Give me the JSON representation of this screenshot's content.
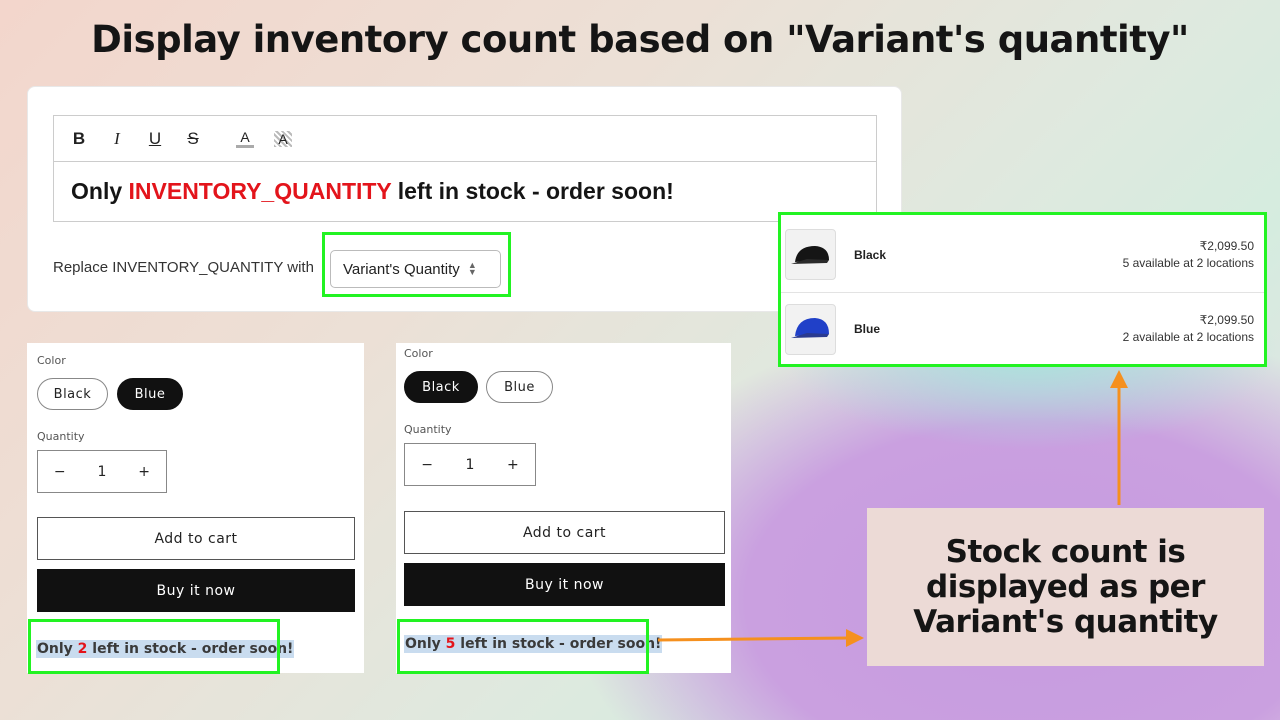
{
  "title": "Display inventory count based on \"Variant's quantity\"",
  "editor": {
    "toolbar": [
      {
        "icon": "bold-icon",
        "glyph": "B"
      },
      {
        "icon": "italic-icon",
        "glyph": "I"
      },
      {
        "icon": "underline-icon",
        "glyph": "U"
      },
      {
        "icon": "strikethrough-icon",
        "glyph": "S"
      },
      {
        "icon": "text-color-icon",
        "glyph": "A"
      },
      {
        "icon": "highlight-color-icon",
        "glyph": "A"
      }
    ],
    "text_before": "Only ",
    "placeholder_token": "INVENTORY_QUANTITY",
    "text_after": " left in stock - order soon!",
    "replace_label": "Replace INVENTORY_QUANTITY with",
    "replace_value": "Variant's Quantity"
  },
  "products": [
    {
      "color_label": "Color",
      "colors": [
        "Black",
        "Blue"
      ],
      "selected": "Blue",
      "quantity_label": "Quantity",
      "quantity": "1",
      "minus": "−",
      "plus": "+",
      "add_to_cart": "Add to cart",
      "buy_now": "Buy it now",
      "msg_before": "Only ",
      "count": "2",
      "msg_after": " left in stock - order soon!"
    },
    {
      "color_label": "Color",
      "colors": [
        "Black",
        "Blue"
      ],
      "selected": "Black",
      "quantity_label": "Quantity",
      "quantity": "1",
      "minus": "−",
      "plus": "+",
      "add_to_cart": "Add to cart",
      "buy_now": "Buy it now",
      "msg_before": "Only ",
      "count": "5",
      "msg_after": " left in stock - order soon!"
    }
  ],
  "variants": [
    {
      "name": "Black",
      "price": "₹2,099.50",
      "availability": "5 available at 2 locations",
      "color": "#151515"
    },
    {
      "name": "Blue",
      "price": "₹2,099.50",
      "availability": "2 available at 2 locations",
      "color": "#2040c8"
    }
  ],
  "callout": "Stock count is displayed as per Variant's quantity",
  "colors": {
    "highlight": "#22f322",
    "arrow": "#f5901e",
    "token": "#e3141b"
  }
}
